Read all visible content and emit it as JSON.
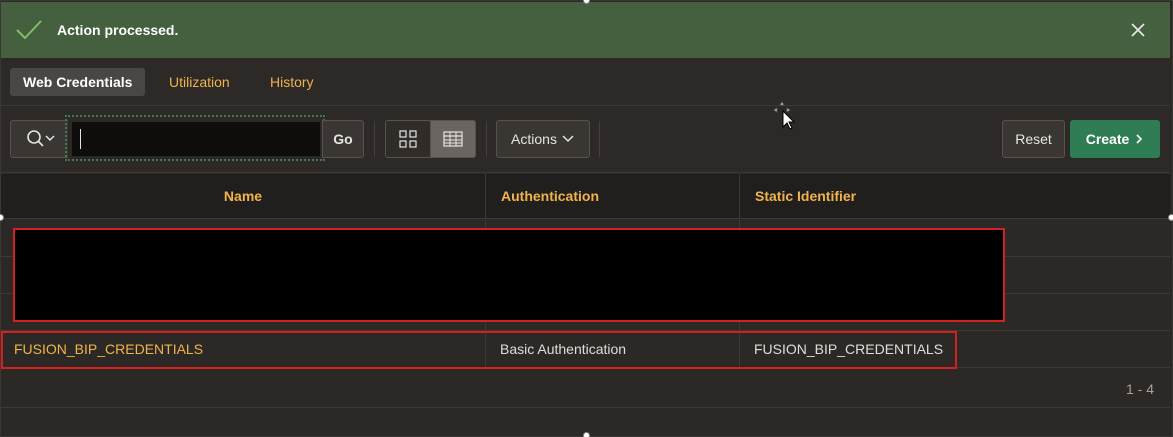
{
  "banner": {
    "message": "Action processed."
  },
  "tabs": [
    {
      "label": "Web Credentials",
      "active": true
    },
    {
      "label": "Utilization",
      "active": false
    },
    {
      "label": "History",
      "active": false
    }
  ],
  "toolbar": {
    "search_value": "",
    "go_label": "Go",
    "actions_label": "Actions",
    "reset_label": "Reset",
    "create_label": "Create"
  },
  "table": {
    "columns": [
      "Name",
      "Authentication",
      "Static Identifier"
    ],
    "rows": [
      {
        "name": "FUSION_BIP_CREDENTIALS",
        "authentication": "Basic Authentication",
        "static_identifier": "FUSION_BIP_CREDENTIALS"
      }
    ]
  },
  "pagination": {
    "range": "1 - 4"
  },
  "colors": {
    "banner_bg": "#44603f",
    "accent": "#f0b44a",
    "create_button": "#2e7d55",
    "highlight_border": "#d42020"
  }
}
